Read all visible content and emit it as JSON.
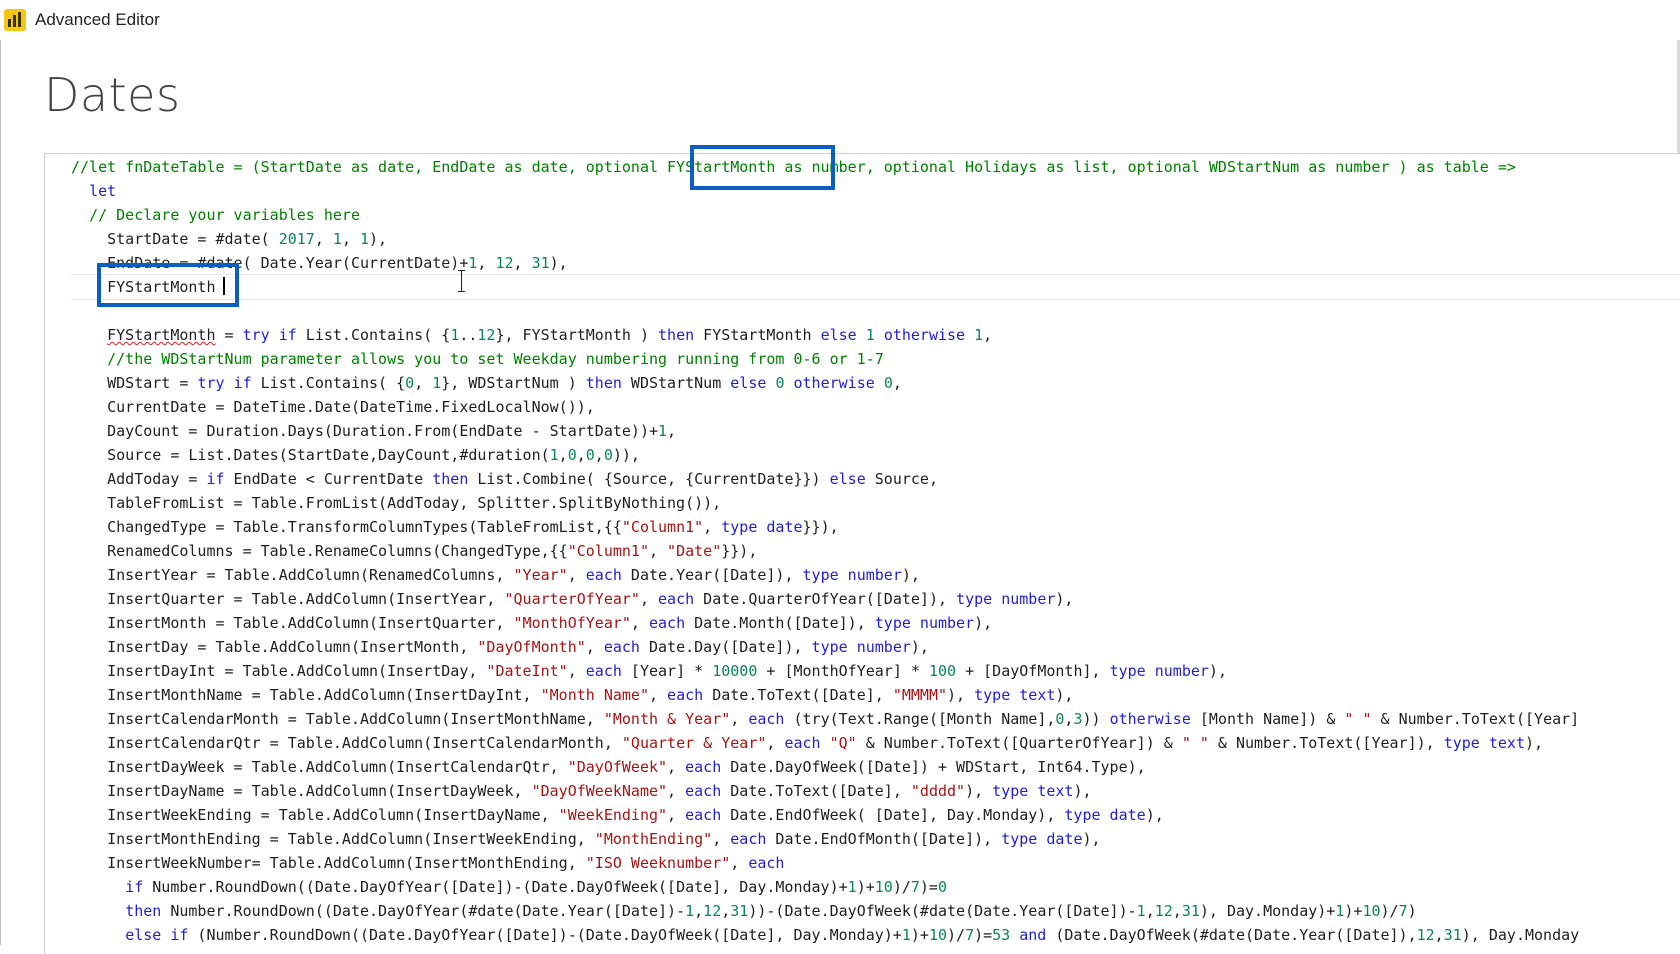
{
  "window": {
    "title": "Advanced Editor",
    "icon": "power-bi-icon",
    "brand_color": "#f2c811"
  },
  "query": {
    "name": "Dates"
  },
  "highlight_color": "#0a5fbf",
  "editor": {
    "current_line_index": 5,
    "lines": [
      [
        {
          "t": "com",
          "v": "//let fnDateTable = (StartDate as date, EndDate as date, optional FYStartMonth as number, optional Holidays as list, optional WDStartNum as number ) as table =>"
        }
      ],
      [
        {
          "t": "plain",
          "v": "  "
        },
        {
          "t": "kw",
          "v": "let"
        }
      ],
      [
        {
          "t": "plain",
          "v": "  "
        },
        {
          "t": "com",
          "v": "// Declare your variables here"
        }
      ],
      [
        {
          "t": "plain",
          "v": "    StartDate = #date( "
        },
        {
          "t": "num",
          "v": "2017"
        },
        {
          "t": "plain",
          "v": ", "
        },
        {
          "t": "num",
          "v": "1"
        },
        {
          "t": "plain",
          "v": ", "
        },
        {
          "t": "num",
          "v": "1"
        },
        {
          "t": "plain",
          "v": "),"
        }
      ],
      [
        {
          "t": "plain",
          "v": "    EndDate = #date( Date.Year(CurrentDate)+"
        },
        {
          "t": "num",
          "v": "1"
        },
        {
          "t": "plain",
          "v": ", "
        },
        {
          "t": "num",
          "v": "12"
        },
        {
          "t": "plain",
          "v": ", "
        },
        {
          "t": "num",
          "v": "31"
        },
        {
          "t": "plain",
          "v": "),"
        }
      ],
      [
        {
          "t": "plain",
          "v": "    FYStartMonth"
        }
      ],
      [
        {
          "t": "plain",
          "v": ""
        }
      ],
      [
        {
          "t": "plain",
          "v": "    "
        },
        {
          "t": "squiggle",
          "v": "FYStartMonth"
        },
        {
          "t": "plain",
          "v": " = "
        },
        {
          "t": "kw",
          "v": "try if"
        },
        {
          "t": "plain",
          "v": " List.Contains( {"
        },
        {
          "t": "num",
          "v": "1"
        },
        {
          "t": "plain",
          "v": ".."
        },
        {
          "t": "num",
          "v": "12"
        },
        {
          "t": "plain",
          "v": "}, FYStartMonth ) "
        },
        {
          "t": "kw",
          "v": "then"
        },
        {
          "t": "plain",
          "v": " FYStartMonth "
        },
        {
          "t": "kw",
          "v": "else"
        },
        {
          "t": "plain",
          "v": " "
        },
        {
          "t": "num",
          "v": "1"
        },
        {
          "t": "plain",
          "v": " "
        },
        {
          "t": "kw",
          "v": "otherwise"
        },
        {
          "t": "plain",
          "v": " "
        },
        {
          "t": "num",
          "v": "1"
        },
        {
          "t": "plain",
          "v": ","
        }
      ],
      [
        {
          "t": "plain",
          "v": "    "
        },
        {
          "t": "com",
          "v": "//the WDStartNum parameter allows you to set Weekday numbering running from 0-6 or 1-7"
        }
      ],
      [
        {
          "t": "plain",
          "v": "    WDStart = "
        },
        {
          "t": "kw",
          "v": "try if"
        },
        {
          "t": "plain",
          "v": " List.Contains( {"
        },
        {
          "t": "num",
          "v": "0"
        },
        {
          "t": "plain",
          "v": ", "
        },
        {
          "t": "num",
          "v": "1"
        },
        {
          "t": "plain",
          "v": "}, WDStartNum ) "
        },
        {
          "t": "kw",
          "v": "then"
        },
        {
          "t": "plain",
          "v": " WDStartNum "
        },
        {
          "t": "kw",
          "v": "else"
        },
        {
          "t": "plain",
          "v": " "
        },
        {
          "t": "num",
          "v": "0"
        },
        {
          "t": "plain",
          "v": " "
        },
        {
          "t": "kw",
          "v": "otherwise"
        },
        {
          "t": "plain",
          "v": " "
        },
        {
          "t": "num",
          "v": "0"
        },
        {
          "t": "plain",
          "v": ","
        }
      ],
      [
        {
          "t": "plain",
          "v": "    CurrentDate = DateTime.Date(DateTime.FixedLocalNow()),"
        }
      ],
      [
        {
          "t": "plain",
          "v": "    DayCount = Duration.Days(Duration.From(EndDate - StartDate))+"
        },
        {
          "t": "num",
          "v": "1"
        },
        {
          "t": "plain",
          "v": ","
        }
      ],
      [
        {
          "t": "plain",
          "v": "    Source = List.Dates(StartDate,DayCount,#duration("
        },
        {
          "t": "num",
          "v": "1"
        },
        {
          "t": "plain",
          "v": ","
        },
        {
          "t": "num",
          "v": "0"
        },
        {
          "t": "plain",
          "v": ","
        },
        {
          "t": "num",
          "v": "0"
        },
        {
          "t": "plain",
          "v": ","
        },
        {
          "t": "num",
          "v": "0"
        },
        {
          "t": "plain",
          "v": ")),"
        }
      ],
      [
        {
          "t": "plain",
          "v": "    AddToday = "
        },
        {
          "t": "kw",
          "v": "if"
        },
        {
          "t": "plain",
          "v": " EndDate < CurrentDate "
        },
        {
          "t": "kw",
          "v": "then"
        },
        {
          "t": "plain",
          "v": " List.Combine( {Source, {CurrentDate}}) "
        },
        {
          "t": "kw",
          "v": "else"
        },
        {
          "t": "plain",
          "v": " Source,"
        }
      ],
      [
        {
          "t": "plain",
          "v": "    TableFromList = Table.FromList(AddToday, Splitter.SplitByNothing()),"
        }
      ],
      [
        {
          "t": "plain",
          "v": "    ChangedType = Table.TransformColumnTypes(TableFromList,{{"
        },
        {
          "t": "str",
          "v": "\"Column1\""
        },
        {
          "t": "plain",
          "v": ", "
        },
        {
          "t": "kw",
          "v": "type date"
        },
        {
          "t": "plain",
          "v": "}}),"
        }
      ],
      [
        {
          "t": "plain",
          "v": "    RenamedColumns = Table.RenameColumns(ChangedType,{{"
        },
        {
          "t": "str",
          "v": "\"Column1\""
        },
        {
          "t": "plain",
          "v": ", "
        },
        {
          "t": "str",
          "v": "\"Date\""
        },
        {
          "t": "plain",
          "v": "}}),"
        }
      ],
      [
        {
          "t": "plain",
          "v": "    InsertYear = Table.AddColumn(RenamedColumns, "
        },
        {
          "t": "str",
          "v": "\"Year\""
        },
        {
          "t": "plain",
          "v": ", "
        },
        {
          "t": "kw",
          "v": "each"
        },
        {
          "t": "plain",
          "v": " Date.Year([Date]), "
        },
        {
          "t": "kw",
          "v": "type number"
        },
        {
          "t": "plain",
          "v": "),"
        }
      ],
      [
        {
          "t": "plain",
          "v": "    InsertQuarter = Table.AddColumn(InsertYear, "
        },
        {
          "t": "str",
          "v": "\"QuarterOfYear\""
        },
        {
          "t": "plain",
          "v": ", "
        },
        {
          "t": "kw",
          "v": "each"
        },
        {
          "t": "plain",
          "v": " Date.QuarterOfYear([Date]), "
        },
        {
          "t": "kw",
          "v": "type number"
        },
        {
          "t": "plain",
          "v": "),"
        }
      ],
      [
        {
          "t": "plain",
          "v": "    InsertMonth = Table.AddColumn(InsertQuarter, "
        },
        {
          "t": "str",
          "v": "\"MonthOfYear\""
        },
        {
          "t": "plain",
          "v": ", "
        },
        {
          "t": "kw",
          "v": "each"
        },
        {
          "t": "plain",
          "v": " Date.Month([Date]), "
        },
        {
          "t": "kw",
          "v": "type number"
        },
        {
          "t": "plain",
          "v": "),"
        }
      ],
      [
        {
          "t": "plain",
          "v": "    InsertDay = Table.AddColumn(InsertMonth, "
        },
        {
          "t": "str",
          "v": "\"DayOfMonth\""
        },
        {
          "t": "plain",
          "v": ", "
        },
        {
          "t": "kw",
          "v": "each"
        },
        {
          "t": "plain",
          "v": " Date.Day([Date]), "
        },
        {
          "t": "kw",
          "v": "type number"
        },
        {
          "t": "plain",
          "v": "),"
        }
      ],
      [
        {
          "t": "plain",
          "v": "    InsertDayInt = Table.AddColumn(InsertDay, "
        },
        {
          "t": "str",
          "v": "\"DateInt\""
        },
        {
          "t": "plain",
          "v": ", "
        },
        {
          "t": "kw",
          "v": "each"
        },
        {
          "t": "plain",
          "v": " [Year] * "
        },
        {
          "t": "num",
          "v": "10000"
        },
        {
          "t": "plain",
          "v": " + [MonthOfYear] * "
        },
        {
          "t": "num",
          "v": "100"
        },
        {
          "t": "plain",
          "v": " + [DayOfMonth], "
        },
        {
          "t": "kw",
          "v": "type number"
        },
        {
          "t": "plain",
          "v": "),"
        }
      ],
      [
        {
          "t": "plain",
          "v": "    InsertMonthName = Table.AddColumn(InsertDayInt, "
        },
        {
          "t": "str",
          "v": "\"Month Name\""
        },
        {
          "t": "plain",
          "v": ", "
        },
        {
          "t": "kw",
          "v": "each"
        },
        {
          "t": "plain",
          "v": " Date.ToText([Date], "
        },
        {
          "t": "str",
          "v": "\"MMMM\""
        },
        {
          "t": "plain",
          "v": "), "
        },
        {
          "t": "kw",
          "v": "type text"
        },
        {
          "t": "plain",
          "v": "),"
        }
      ],
      [
        {
          "t": "plain",
          "v": "    InsertCalendarMonth = Table.AddColumn(InsertMonthName, "
        },
        {
          "t": "str",
          "v": "\"Month & Year\""
        },
        {
          "t": "plain",
          "v": ", "
        },
        {
          "t": "kw",
          "v": "each"
        },
        {
          "t": "plain",
          "v": " (try(Text.Range([Month Name],"
        },
        {
          "t": "num",
          "v": "0"
        },
        {
          "t": "plain",
          "v": ","
        },
        {
          "t": "num",
          "v": "3"
        },
        {
          "t": "plain",
          "v": ")) "
        },
        {
          "t": "kw",
          "v": "otherwise"
        },
        {
          "t": "plain",
          "v": " [Month Name]) & "
        },
        {
          "t": "str",
          "v": "\" \""
        },
        {
          "t": "plain",
          "v": " & Number.ToText([Year]"
        }
      ],
      [
        {
          "t": "plain",
          "v": "    InsertCalendarQtr = Table.AddColumn(InsertCalendarMonth, "
        },
        {
          "t": "str",
          "v": "\"Quarter & Year\""
        },
        {
          "t": "plain",
          "v": ", "
        },
        {
          "t": "kw",
          "v": "each"
        },
        {
          "t": "plain",
          "v": " "
        },
        {
          "t": "str",
          "v": "\"Q\""
        },
        {
          "t": "plain",
          "v": " & Number.ToText([QuarterOfYear]) & "
        },
        {
          "t": "str",
          "v": "\" \""
        },
        {
          "t": "plain",
          "v": " & Number.ToText([Year]), "
        },
        {
          "t": "kw",
          "v": "type text"
        },
        {
          "t": "plain",
          "v": "),"
        }
      ],
      [
        {
          "t": "plain",
          "v": "    InsertDayWeek = Table.AddColumn(InsertCalendarQtr, "
        },
        {
          "t": "str",
          "v": "\"DayOfWeek\""
        },
        {
          "t": "plain",
          "v": ", "
        },
        {
          "t": "kw",
          "v": "each"
        },
        {
          "t": "plain",
          "v": " Date.DayOfWeek([Date]) + WDStart, Int64.Type),"
        }
      ],
      [
        {
          "t": "plain",
          "v": "    InsertDayName = Table.AddColumn(InsertDayWeek, "
        },
        {
          "t": "str",
          "v": "\"DayOfWeekName\""
        },
        {
          "t": "plain",
          "v": ", "
        },
        {
          "t": "kw",
          "v": "each"
        },
        {
          "t": "plain",
          "v": " Date.ToText([Date], "
        },
        {
          "t": "str",
          "v": "\"dddd\""
        },
        {
          "t": "plain",
          "v": "), "
        },
        {
          "t": "kw",
          "v": "type text"
        },
        {
          "t": "plain",
          "v": "),"
        }
      ],
      [
        {
          "t": "plain",
          "v": "    InsertWeekEnding = Table.AddColumn(InsertDayName, "
        },
        {
          "t": "str",
          "v": "\"WeekEnding\""
        },
        {
          "t": "plain",
          "v": ", "
        },
        {
          "t": "kw",
          "v": "each"
        },
        {
          "t": "plain",
          "v": " Date.EndOfWeek( [Date], Day.Monday), "
        },
        {
          "t": "kw",
          "v": "type date"
        },
        {
          "t": "plain",
          "v": "),"
        }
      ],
      [
        {
          "t": "plain",
          "v": "    InsertMonthEnding = Table.AddColumn(InsertWeekEnding, "
        },
        {
          "t": "str",
          "v": "\"MonthEnding\""
        },
        {
          "t": "plain",
          "v": ", "
        },
        {
          "t": "kw",
          "v": "each"
        },
        {
          "t": "plain",
          "v": " Date.EndOfMonth([Date]), "
        },
        {
          "t": "kw",
          "v": "type date"
        },
        {
          "t": "plain",
          "v": "),"
        }
      ],
      [
        {
          "t": "plain",
          "v": "    InsertWeekNumber= Table.AddColumn(InsertMonthEnding, "
        },
        {
          "t": "str",
          "v": "\"ISO Weeknumber\""
        },
        {
          "t": "plain",
          "v": ", "
        },
        {
          "t": "kw",
          "v": "each"
        }
      ],
      [
        {
          "t": "plain",
          "v": "      "
        },
        {
          "t": "kw",
          "v": "if"
        },
        {
          "t": "plain",
          "v": " Number.RoundDown((Date.DayOfYear([Date])-(Date.DayOfWeek([Date], Day.Monday)+"
        },
        {
          "t": "num",
          "v": "1"
        },
        {
          "t": "plain",
          "v": ")+"
        },
        {
          "t": "num",
          "v": "10"
        },
        {
          "t": "plain",
          "v": ")/"
        },
        {
          "t": "num",
          "v": "7"
        },
        {
          "t": "plain",
          "v": ")="
        },
        {
          "t": "num",
          "v": "0"
        }
      ],
      [
        {
          "t": "plain",
          "v": "      "
        },
        {
          "t": "kw",
          "v": "then"
        },
        {
          "t": "plain",
          "v": " Number.RoundDown((Date.DayOfYear(#date(Date.Year([Date])-"
        },
        {
          "t": "num",
          "v": "1"
        },
        {
          "t": "plain",
          "v": ","
        },
        {
          "t": "num",
          "v": "12"
        },
        {
          "t": "plain",
          "v": ","
        },
        {
          "t": "num",
          "v": "31"
        },
        {
          "t": "plain",
          "v": "))-(Date.DayOfWeek(#date(Date.Year([Date])-"
        },
        {
          "t": "num",
          "v": "1"
        },
        {
          "t": "plain",
          "v": ","
        },
        {
          "t": "num",
          "v": "12"
        },
        {
          "t": "plain",
          "v": ","
        },
        {
          "t": "num",
          "v": "31"
        },
        {
          "t": "plain",
          "v": "), Day.Monday)+"
        },
        {
          "t": "num",
          "v": "1"
        },
        {
          "t": "plain",
          "v": ")+"
        },
        {
          "t": "num",
          "v": "10"
        },
        {
          "t": "plain",
          "v": ")/"
        },
        {
          "t": "num",
          "v": "7"
        },
        {
          "t": "plain",
          "v": ")"
        }
      ],
      [
        {
          "t": "plain",
          "v": "      "
        },
        {
          "t": "kw",
          "v": "else if"
        },
        {
          "t": "plain",
          "v": " (Number.RoundDown((Date.DayOfYear([Date])-(Date.DayOfWeek([Date], Day.Monday)+"
        },
        {
          "t": "num",
          "v": "1"
        },
        {
          "t": "plain",
          "v": ")+"
        },
        {
          "t": "num",
          "v": "10"
        },
        {
          "t": "plain",
          "v": ")/"
        },
        {
          "t": "num",
          "v": "7"
        },
        {
          "t": "plain",
          "v": ")="
        },
        {
          "t": "num",
          "v": "53"
        },
        {
          "t": "plain",
          "v": " "
        },
        {
          "t": "kw",
          "v": "and"
        },
        {
          "t": "plain",
          "v": " (Date.DayOfWeek(#date(Date.Year([Date]),"
        },
        {
          "t": "num",
          "v": "12"
        },
        {
          "t": "plain",
          "v": ","
        },
        {
          "t": "num",
          "v": "31"
        },
        {
          "t": "plain",
          "v": "), Day.Monday"
        }
      ]
    ]
  }
}
